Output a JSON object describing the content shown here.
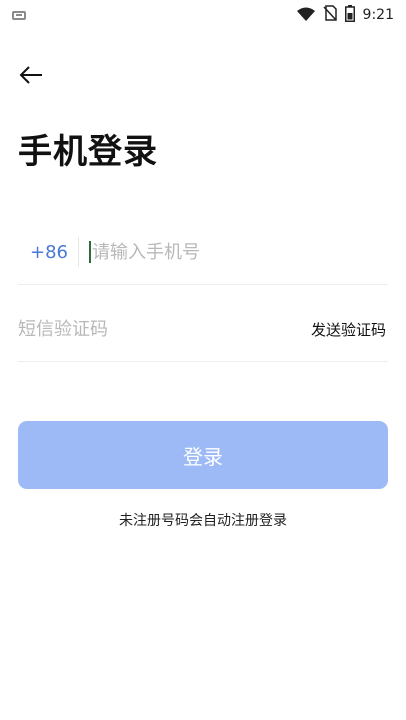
{
  "status_bar": {
    "time": "9:21",
    "icons": [
      "notification-icon",
      "wifi-icon",
      "no-sim-icon",
      "battery-icon"
    ]
  },
  "header": {
    "back_icon": "back-arrow-icon",
    "title": "手机登录"
  },
  "phone": {
    "country_code": "+86",
    "placeholder": "请输入手机号",
    "value": ""
  },
  "code": {
    "placeholder": "短信验证码",
    "value": "",
    "send_label": "发送验证码"
  },
  "login": {
    "label": "登录"
  },
  "note": {
    "text": "未注册号码会自动注册登录"
  },
  "colors": {
    "accent": "#4a78d6",
    "button": "#9dbaf7",
    "placeholder": "#b8b8b8"
  }
}
